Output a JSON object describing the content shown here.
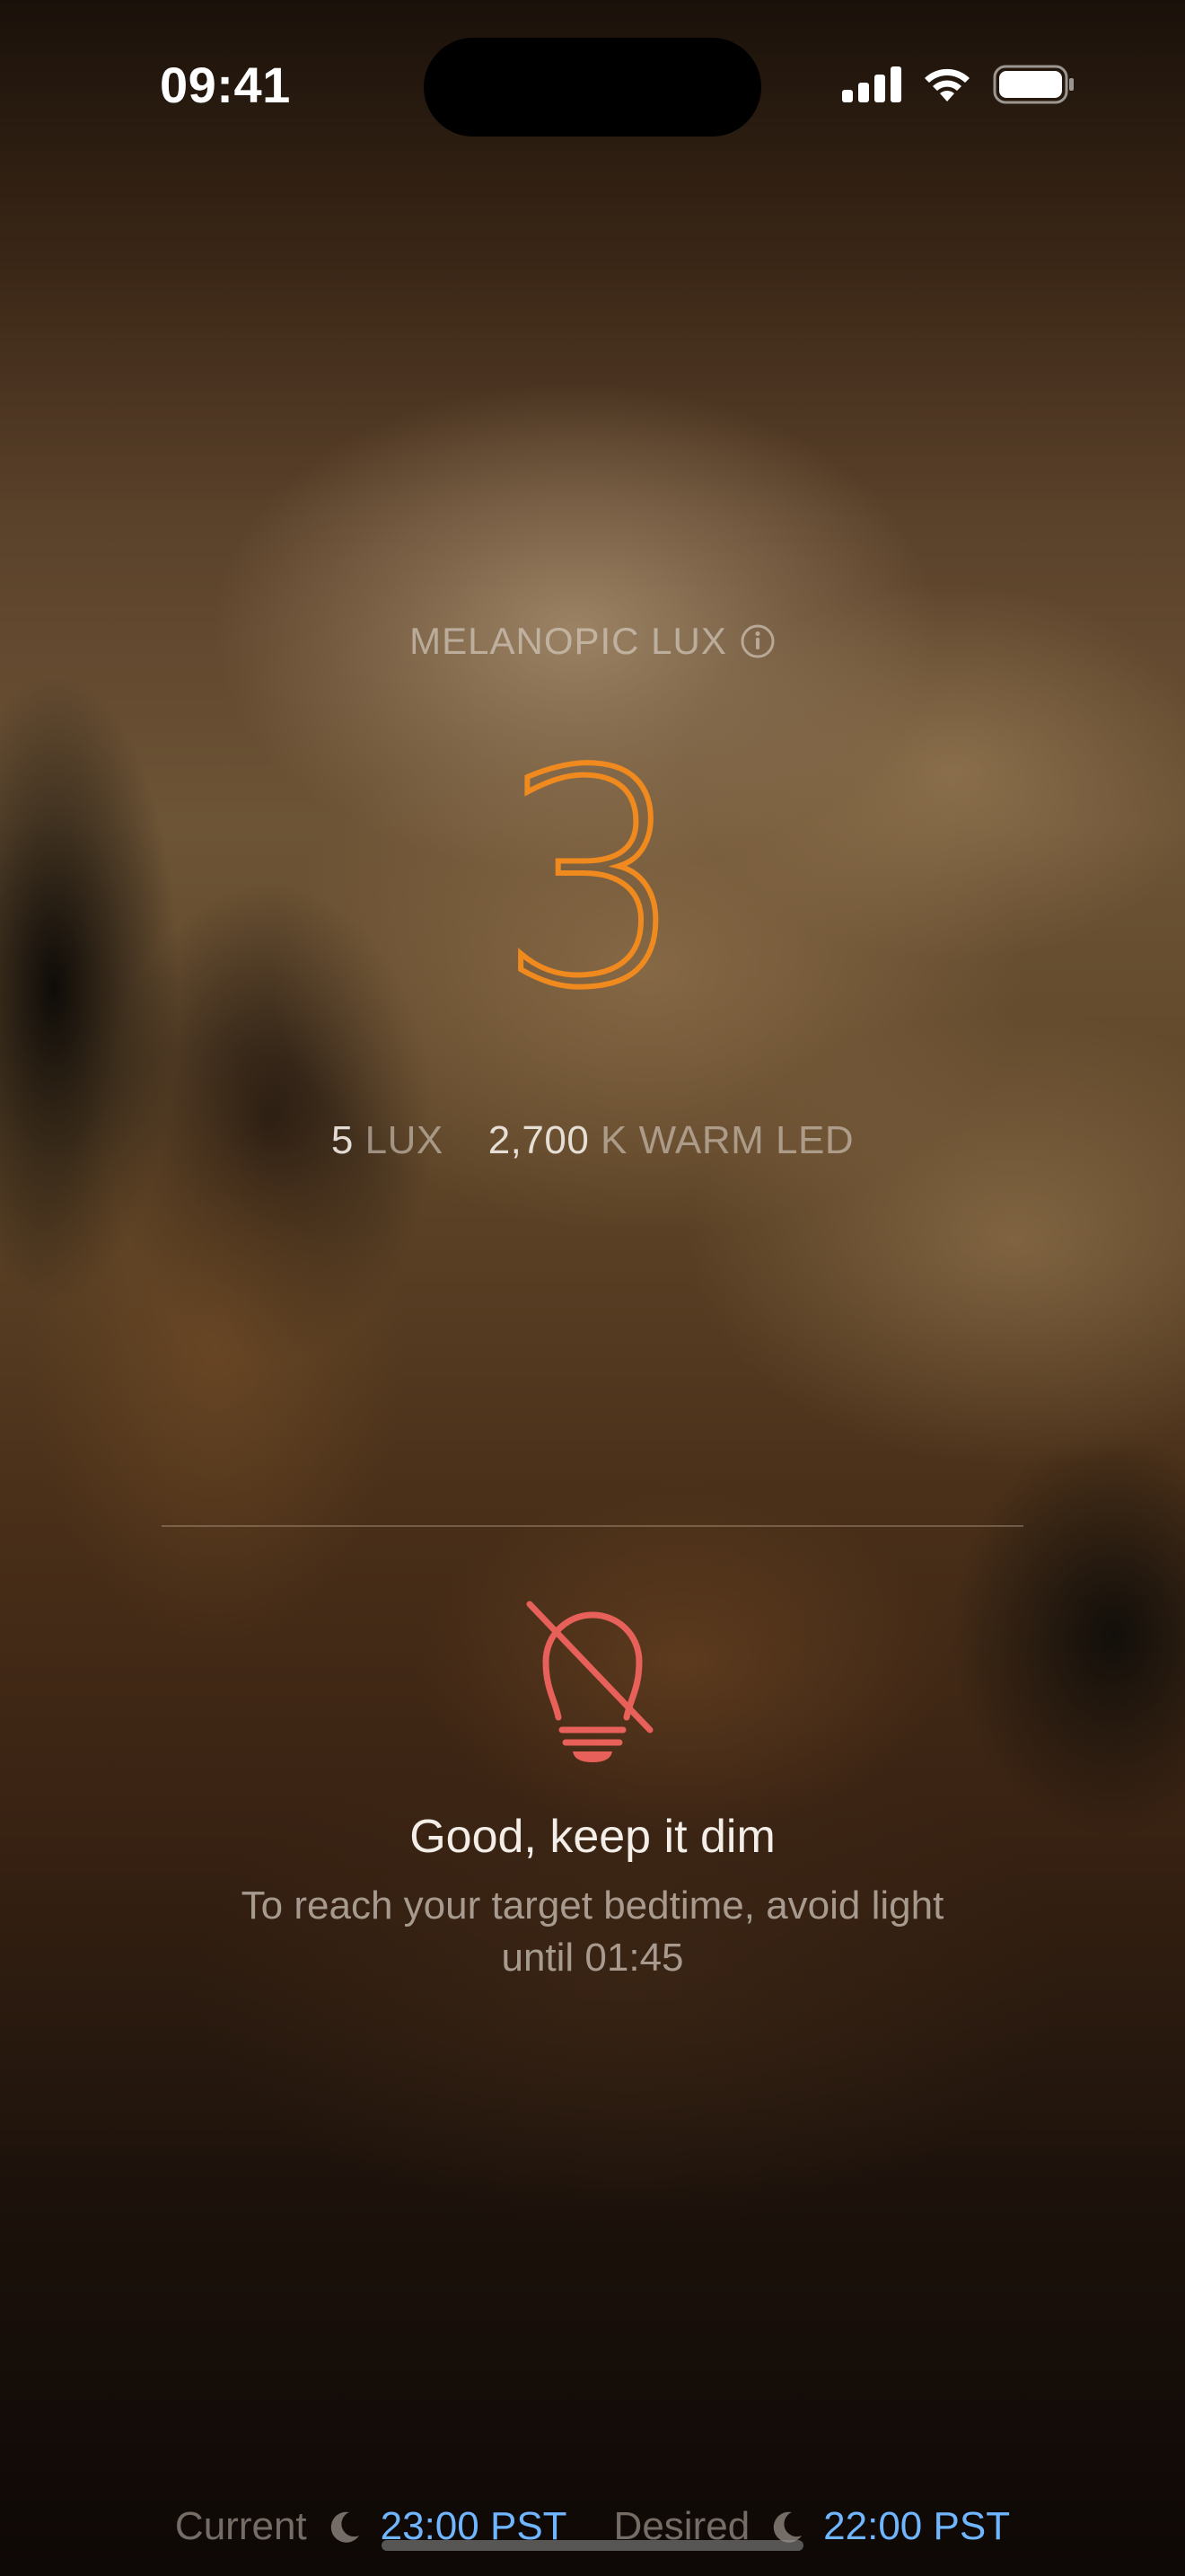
{
  "status_bar": {
    "time": "09:41"
  },
  "metric": {
    "label": "MELANOPIC LUX",
    "value": "3",
    "lux_value": "5",
    "lux_unit": "LUX",
    "temp_value": "2,700",
    "temp_unit": "K WARM LED",
    "accent_color": "#f08a1e"
  },
  "message": {
    "title": "Good, keep it dim",
    "body": "To reach your target bedtime, avoid light until 01:45",
    "icon": "lightbulb-off-icon",
    "icon_color": "#e8605a"
  },
  "bedtime": {
    "current_label": "Current",
    "current_time": "23:00 PST",
    "desired_label": "Desired",
    "desired_time": "22:00 PST",
    "time_color": "#6fb6ff"
  }
}
